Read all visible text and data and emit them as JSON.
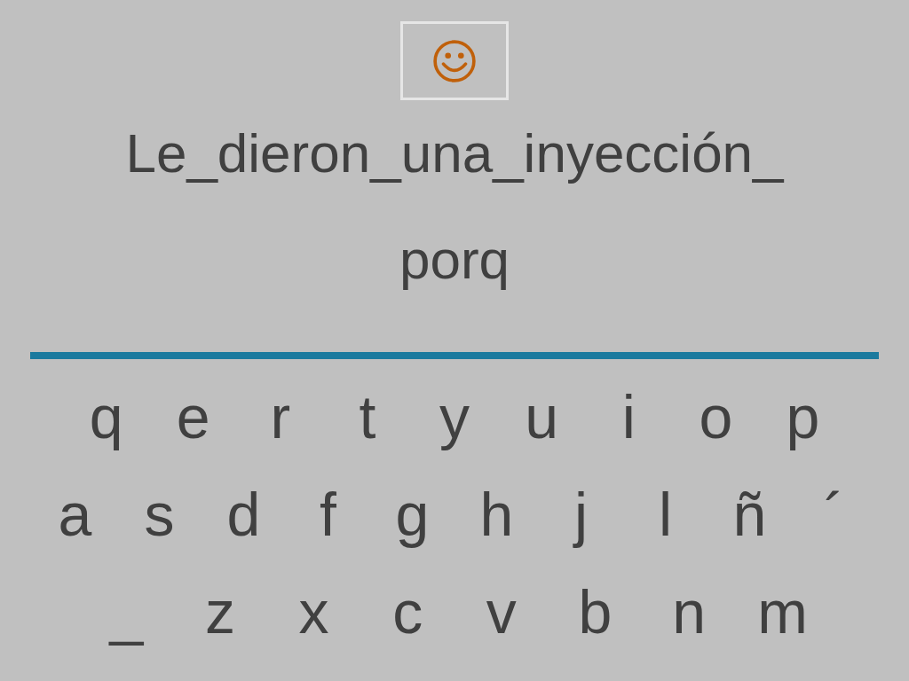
{
  "feedback": {
    "kind": "smile"
  },
  "phrase_lines": [
    "Le_dieron_una_inyección_",
    "porq"
  ],
  "keyboard": {
    "rows": [
      [
        "q",
        "e",
        "r",
        "t",
        "y",
        "u",
        "i",
        "o",
        "p"
      ],
      [
        "a",
        "s",
        "d",
        "f",
        "g",
        "h",
        "j",
        "l",
        "ñ",
        "´"
      ],
      [
        "_",
        "z",
        "x",
        "c",
        "v",
        "b",
        "n",
        "m"
      ]
    ]
  }
}
